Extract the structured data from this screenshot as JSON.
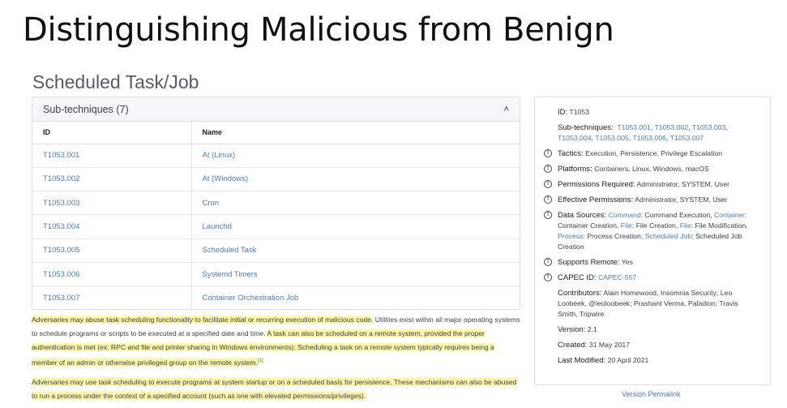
{
  "slide_title": "Distinguishing Malicious from Benign",
  "page_heading": "Scheduled Task/Job",
  "subtechniques": {
    "header": "Sub-techniques (7)",
    "col_id": "ID",
    "col_name": "Name",
    "rows": [
      {
        "id": "T1053.001",
        "name": "At (Linux)"
      },
      {
        "id": "T1053.002",
        "name": "At (Windows)"
      },
      {
        "id": "T1053.003",
        "name": "Cron"
      },
      {
        "id": "T1053.004",
        "name": "Launchd"
      },
      {
        "id": "T1053.005",
        "name": "Scheduled Task"
      },
      {
        "id": "T1053.006",
        "name": "Systemd Timers"
      },
      {
        "id": "T1053.007",
        "name": "Container Orchestration Job"
      }
    ]
  },
  "description": {
    "p1_hl1": "Adversaries may abuse task scheduling functionality to facilitate initial or recurring execution of malicious code.",
    "p1_plain": " Utilities exist within all major operating systems to schedule programs or scripts to be executed at a specified date and time. ",
    "p1_hl2": "A task can also be scheduled on a remote system, provided the proper authentication is met (ex: RPC and file and printer sharing in Windows environments). Scheduling a task on a remote system typically requires being a member of an admin or otherwise privileged group on the remote system.",
    "p1_cite": "[1]",
    "p2_hl": "Adversaries may use task scheduling to execute programs at system startup or on a scheduled basis for persistence. These mechanisms can also be abused to run a process under the context of a specified account (such as one with elevated permissions/privileges)."
  },
  "info": {
    "id_label": "ID:",
    "id_value": "T1053",
    "subtech_label": "Sub-techniques:",
    "subtech_links": [
      "T1053.001",
      "T1053.002",
      "T1053.003",
      "T1053.004",
      "T1053.005",
      "T1053.006",
      "T1053.007"
    ],
    "tactics_label": "Tactics:",
    "tactics_value": "Execution, Persistence, Privilege Escalation",
    "platforms_label": "Platforms:",
    "platforms_value": "Containers, Linux, Windows, macOS",
    "perm_req_label": "Permissions Required:",
    "perm_req_value": "Administrator, SYSTEM, User",
    "eff_perm_label": "Effective Permissions:",
    "eff_perm_value": "Administrator, SYSTEM, User",
    "ds_label": "Data Sources:",
    "ds_items": [
      {
        "link": "Command",
        "text": ": Command Execution,"
      },
      {
        "link": "Container",
        "text": ": Container Creation,"
      },
      {
        "link": "File",
        "text": ": File Creation,"
      },
      {
        "link": "File",
        "text": ": File Modification,"
      },
      {
        "link": "Process",
        "text": ": Process Creation,"
      },
      {
        "link": "Scheduled Job",
        "text": ": Scheduled Job Creation"
      }
    ],
    "remote_label": "Supports Remote:",
    "remote_value": "Yes",
    "capec_label": "CAPEC ID:",
    "capec_value": "CAPEC-557",
    "contrib_label": "Contributors:",
    "contrib_value": "Alain Homewood, Insomnia Security; Leo Loobeek, @leoloobeek; Prashant Verma, Paladion; Travis Smith, Tripwire",
    "version_label": "Version:",
    "version_value": "2.1",
    "created_label": "Created:",
    "created_value": "31 May 2017",
    "modified_label": "Last Modified:",
    "modified_value": "20 April 2021",
    "info_icon": "info-circle-icon"
  },
  "permalink": "Version Permalink"
}
